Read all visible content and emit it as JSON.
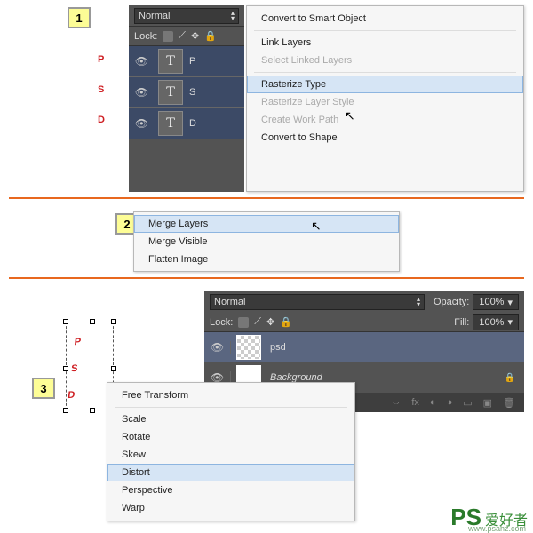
{
  "badges": {
    "b1": "1",
    "b2": "2",
    "b3": "3"
  },
  "step1": {
    "blend": "Normal",
    "lock": "Lock:",
    "layers": [
      {
        "name": "P"
      },
      {
        "name": "S"
      },
      {
        "name": "D"
      }
    ],
    "psd": [
      "P",
      "S",
      "D"
    ],
    "menu": [
      {
        "label": "Convert to Smart Object",
        "disabled": false
      },
      {
        "sep": true
      },
      {
        "label": "Link Layers",
        "disabled": false
      },
      {
        "label": "Select Linked Layers",
        "disabled": true
      },
      {
        "sep": true
      },
      {
        "label": "Rasterize Type",
        "hl": true
      },
      {
        "label": "Rasterize Layer Style",
        "disabled": true
      },
      {
        "label": "Create Work Path",
        "disabled": true
      },
      {
        "label": "Convert to Shape",
        "disabled": false
      }
    ]
  },
  "step2": {
    "menu": [
      {
        "label": "Merge Layers",
        "hl": true
      },
      {
        "label": "Merge Visible"
      },
      {
        "label": "Flatten Image"
      }
    ]
  },
  "step3": {
    "blend": "Normal",
    "opacity_label": "Opacity:",
    "opacity_val": "100%",
    "lock": "Lock:",
    "fill_label": "Fill:",
    "fill_val": "100%",
    "layers": [
      {
        "name": "psd",
        "sel": true,
        "checker": true
      },
      {
        "name": "Background",
        "sel": false,
        "italic": true,
        "lock": true
      }
    ],
    "psd": [
      "P",
      "S",
      "D"
    ],
    "menu": [
      {
        "label": "Free Transform"
      },
      {
        "sep": true
      },
      {
        "label": "Scale"
      },
      {
        "label": "Rotate"
      },
      {
        "label": "Skew"
      },
      {
        "label": "Distort",
        "hl": true
      },
      {
        "label": "Perspective"
      },
      {
        "label": "Warp"
      }
    ]
  },
  "watermark": {
    "ps": "PS",
    "cn": "爱好者",
    "url": "www.psahz.com"
  }
}
